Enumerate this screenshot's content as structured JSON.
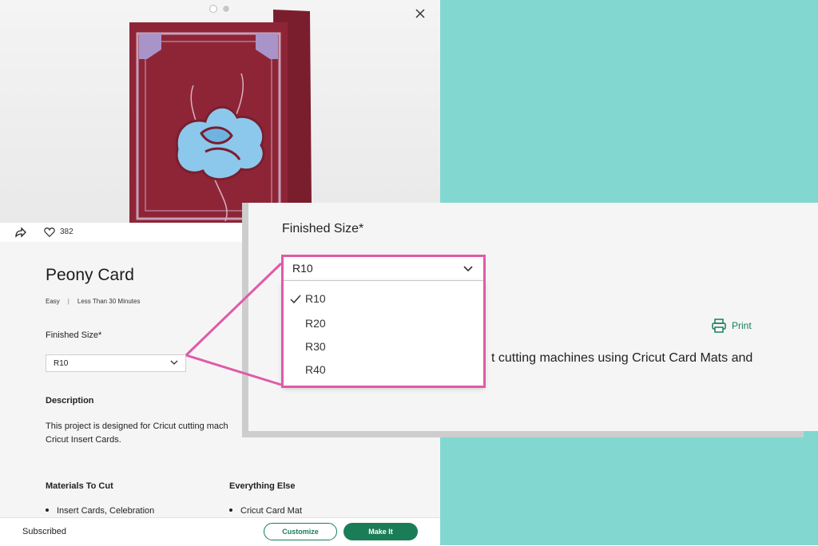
{
  "colors": {
    "teal": "#82d8d0",
    "brand_green": "#1a7d57",
    "highlight_pink": "#e05aa8",
    "card_red": "#8e2537",
    "card_blue": "#8cc8ec"
  },
  "hero": {
    "dots_count": 2,
    "close_icon": "close-icon"
  },
  "actions": {
    "like_count": "382"
  },
  "project": {
    "title": "Peony Card",
    "difficulty": "Easy",
    "duration": "Less Than 30 Minutes",
    "size_label": "Finished Size*",
    "selected_size": "R10",
    "description_heading": "Description",
    "description_text": "This project is designed for Cricut cutting mach",
    "description_text_2": "Cricut Insert Cards.",
    "materials_heading": "Materials To Cut",
    "materials_item": "Insert Cards, Celebration",
    "else_heading": "Everything Else",
    "else_item": "Cricut Card Mat"
  },
  "footer": {
    "status": "Subscribed",
    "customize_label": "Customize",
    "make_label": "Make It"
  },
  "zoom": {
    "size_label": "Finished Size*",
    "selected": "R10",
    "options": [
      "R10",
      "R20",
      "R30",
      "R40"
    ],
    "print_label": "Print",
    "desc_fragment": "t cutting machines using Cricut Card Mats and"
  }
}
